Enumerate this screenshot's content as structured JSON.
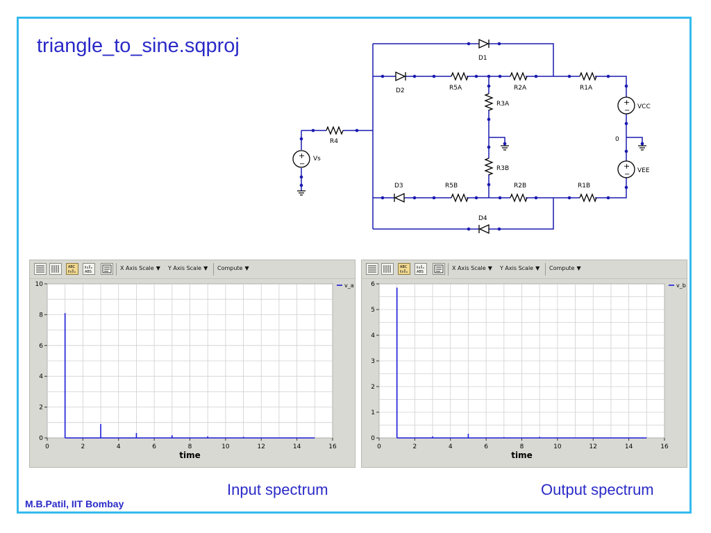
{
  "slide": {
    "title": "triangle_to_sine.sqproj",
    "author": "M.B.Patil, IIT Bombay",
    "accent_color": "#2a2ac8",
    "frame_color": "#33bbee"
  },
  "circuit": {
    "components": {
      "D1": "D1",
      "D2": "D2",
      "D3": "D3",
      "D4": "D4",
      "R5A": "R5A",
      "R2A": "R2A",
      "R1A": "R1A",
      "R3A": "R3A",
      "R3B": "R3B",
      "R5B": "R5B",
      "R2B": "R2B",
      "R1B": "R1B",
      "R4": "R4",
      "Vs": "Vs",
      "VCC": "VCC",
      "VEE": "VEE",
      "ground_node": "0"
    },
    "wire_color": "#1a1ab0"
  },
  "toolbar": {
    "x_axis_scale": "X Axis Scale",
    "y_axis_scale": "Y Axis Scale",
    "compute": "Compute",
    "btn_abc": "ABC",
    "btn_abs": "ABS"
  },
  "captions": {
    "input": "Input spectrum",
    "output": "Output spectrum"
  },
  "chart_data": [
    {
      "type": "bar",
      "title": "",
      "xlabel": "time",
      "ylabel": "",
      "xlim": [
        0,
        16
      ],
      "ylim": [
        0,
        10
      ],
      "x_ticks": [
        0,
        2,
        4,
        6,
        8,
        10,
        12,
        14,
        16
      ],
      "y_ticks": [
        0,
        2,
        4,
        6,
        8,
        10
      ],
      "grid": true,
      "legend_position": "top-right",
      "baseline_end": 15,
      "series": [
        {
          "name": "v_a",
          "color": "#1a1ad8",
          "x": [
            1,
            3,
            5,
            7,
            9,
            11
          ],
          "values": [
            8.1,
            0.9,
            0.32,
            0.17,
            0.1,
            0.07
          ]
        }
      ]
    },
    {
      "type": "bar",
      "title": "",
      "xlabel": "time",
      "ylabel": "",
      "xlim": [
        0,
        16
      ],
      "ylim": [
        0,
        6
      ],
      "x_ticks": [
        0,
        2,
        4,
        6,
        8,
        10,
        12,
        14,
        16
      ],
      "y_ticks": [
        0,
        1,
        2,
        3,
        4,
        5,
        6
      ],
      "grid": true,
      "legend_position": "top-right",
      "baseline_end": 15,
      "series": [
        {
          "name": "v_b",
          "color": "#1a1ad8",
          "x": [
            1,
            3,
            5,
            7,
            9
          ],
          "values": [
            5.85,
            0.06,
            0.16,
            0.03,
            0.04
          ]
        }
      ]
    }
  ]
}
